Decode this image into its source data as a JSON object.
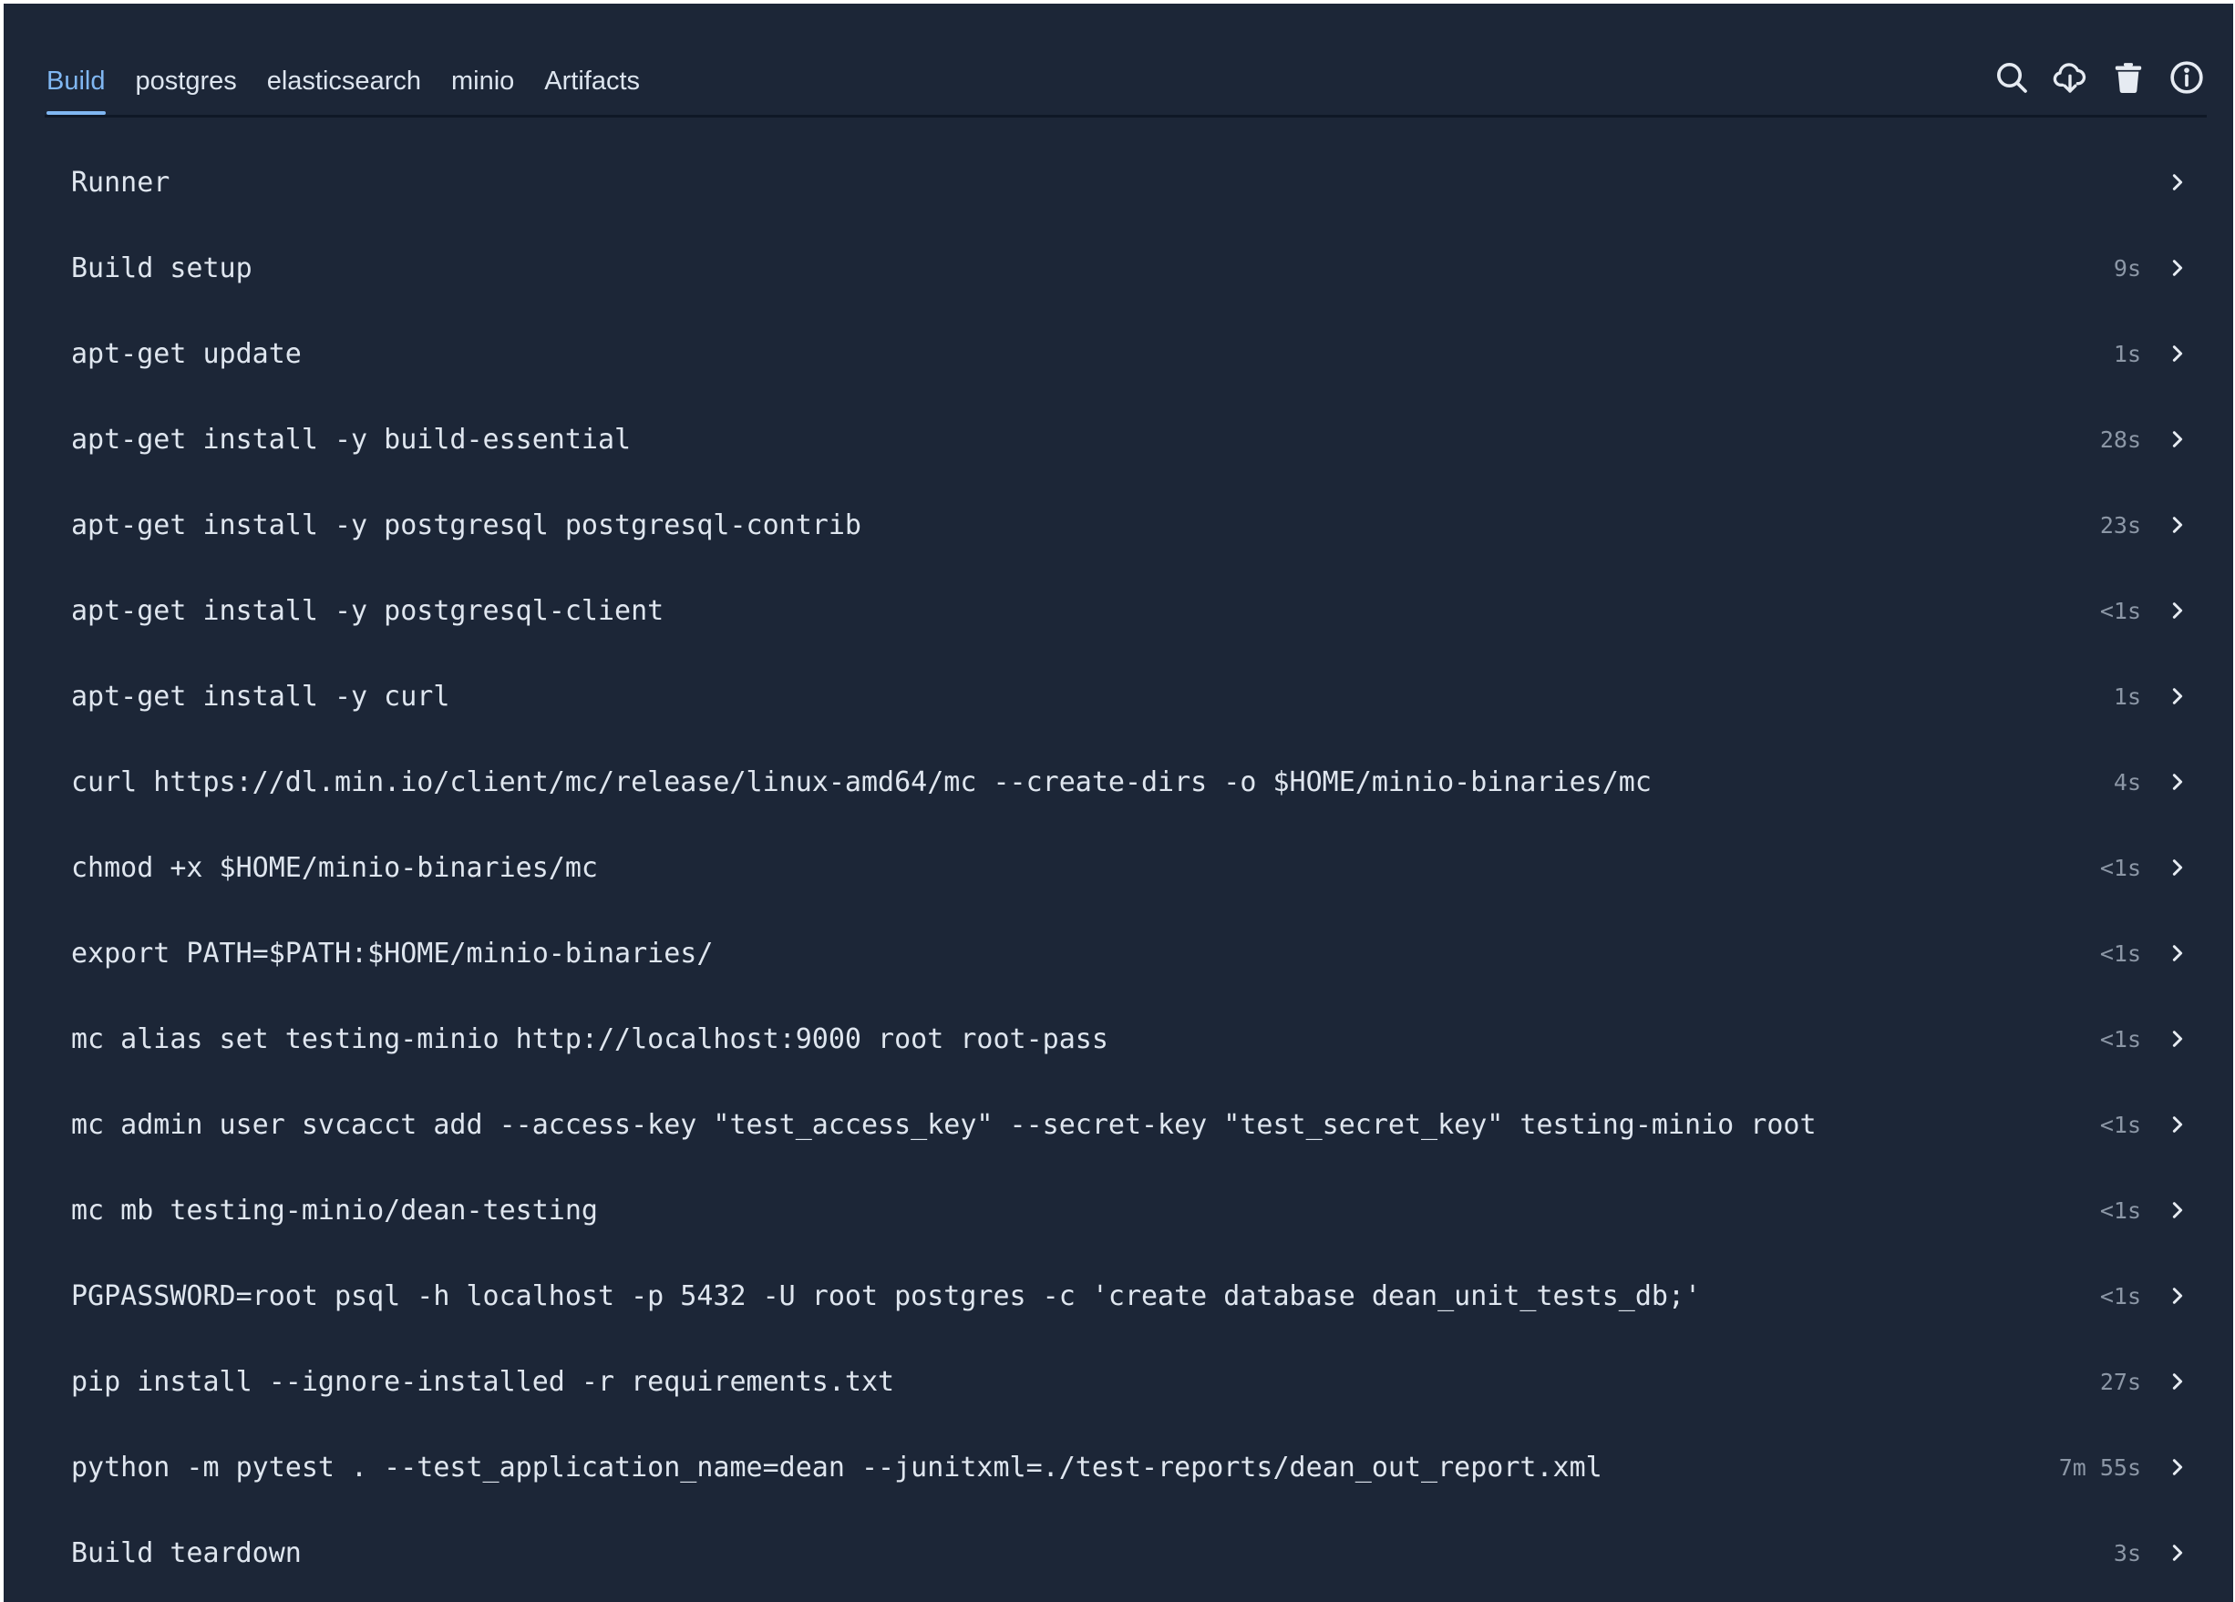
{
  "tabs": [
    {
      "label": "Build",
      "active": true
    },
    {
      "label": "postgres",
      "active": false
    },
    {
      "label": "elasticsearch",
      "active": false
    },
    {
      "label": "minio",
      "active": false
    },
    {
      "label": "Artifacts",
      "active": false
    }
  ],
  "toolbar": {
    "icons": [
      "search-icon",
      "cloud-download-icon",
      "trash-icon",
      "info-icon"
    ]
  },
  "steps": [
    {
      "name": "Runner",
      "duration": ""
    },
    {
      "name": "Build setup",
      "duration": "9s"
    },
    {
      "name": "apt-get update",
      "duration": "1s"
    },
    {
      "name": "apt-get install -y build-essential",
      "duration": "28s"
    },
    {
      "name": "apt-get install -y postgresql postgresql-contrib",
      "duration": "23s"
    },
    {
      "name": "apt-get install -y postgresql-client",
      "duration": "<1s"
    },
    {
      "name": "apt-get install -y curl",
      "duration": "1s"
    },
    {
      "name": "curl https://dl.min.io/client/mc/release/linux-amd64/mc --create-dirs -o $HOME/minio-binaries/mc",
      "duration": "4s"
    },
    {
      "name": "chmod +x $HOME/minio-binaries/mc",
      "duration": "<1s"
    },
    {
      "name": "export PATH=$PATH:$HOME/minio-binaries/",
      "duration": "<1s"
    },
    {
      "name": "mc alias set testing-minio http://localhost:9000 root root-pass",
      "duration": "<1s"
    },
    {
      "name": "mc admin user svcacct add --access-key \"test_access_key\" --secret-key \"test_secret_key\" testing-minio root",
      "duration": "<1s"
    },
    {
      "name": "mc mb testing-minio/dean-testing",
      "duration": "<1s"
    },
    {
      "name": "PGPASSWORD=root psql -h localhost -p 5432 -U root postgres -c 'create database dean_unit_tests_db;'",
      "duration": "<1s"
    },
    {
      "name": "pip install --ignore-installed -r requirements.txt",
      "duration": "27s"
    },
    {
      "name": "python -m pytest . --test_application_name=dean --junitxml=./test-reports/dean_out_report.xml",
      "duration": "7m 55s"
    },
    {
      "name": "Build teardown",
      "duration": "3s"
    }
  ],
  "colors": {
    "background": "#1c2637",
    "accent": "#80b7f2",
    "text": "#dfe6ef",
    "muted": "#8c97a6"
  }
}
